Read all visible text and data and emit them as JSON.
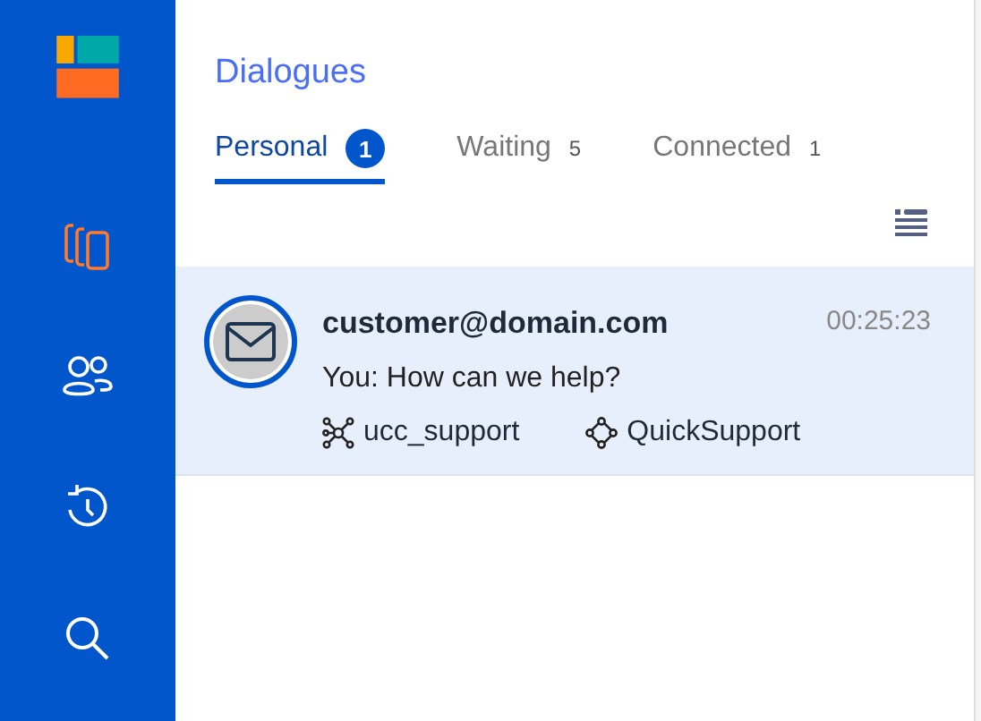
{
  "sidebar": {
    "items": [
      {
        "selected": true
      },
      {
        "selected": false
      },
      {
        "selected": false
      },
      {
        "selected": false
      }
    ]
  },
  "title": "Dialogues",
  "tabs": [
    {
      "label": "Personal",
      "count": "1",
      "selected": true
    },
    {
      "label": "Waiting",
      "count": "5",
      "selected": false
    },
    {
      "label": "Connected",
      "count": "1",
      "selected": false
    }
  ],
  "conversations": [
    {
      "contact": "customer@domain.com",
      "time": "00:25:23",
      "message": "You: How can we help?",
      "group": "ucc_support",
      "channel": "QuickSupport",
      "selected": true
    }
  ]
}
